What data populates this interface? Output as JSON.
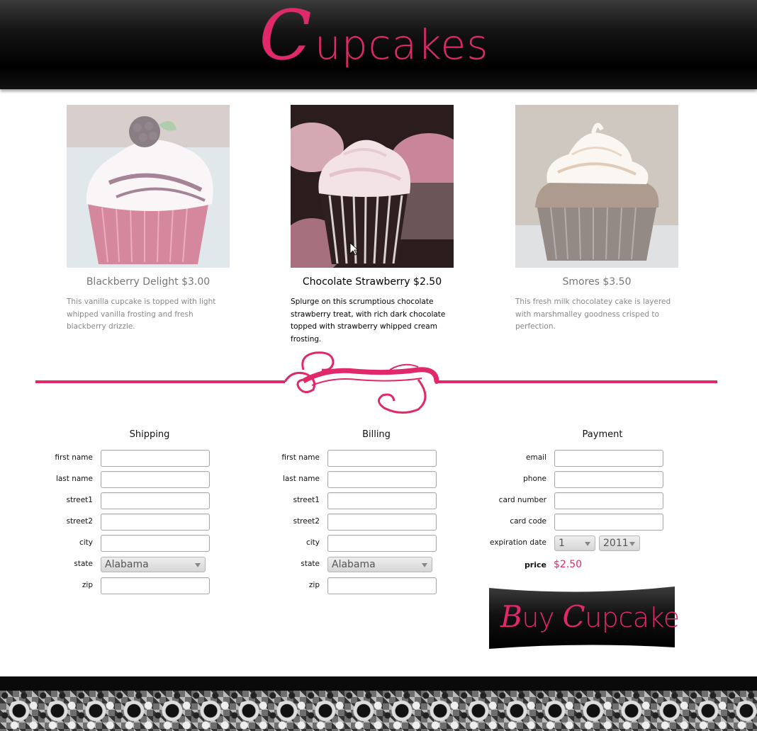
{
  "header": {
    "logo_initial": "C",
    "logo_text": "upcakes",
    "accent_color": "#e0286b"
  },
  "products": [
    {
      "name": "Blackberry Delight $3.00",
      "description": "This vanilla cupcake is topped with light whipped vanilla frosting and fresh blackberry drizzle.",
      "selected": false
    },
    {
      "name": "Chocolate Strawberry $2.50",
      "description": "Splurge on this scrumptious chocolate strawberry treat, with rich dark chocolate topped with strawberry whipped cream frosting.",
      "selected": true
    },
    {
      "name": "Smores $3.50",
      "description": "This fresh milk chocolatey cake is layered with marshmalley goodness crisped to perfection.",
      "selected": false
    }
  ],
  "shipping": {
    "title": "Shipping",
    "labels": {
      "first_name": "first name",
      "last_name": "last name",
      "street1": "street1",
      "street2": "street2",
      "city": "city",
      "state": "state",
      "zip": "zip"
    },
    "state_value": "Alabama"
  },
  "billing": {
    "title": "Billing",
    "labels": {
      "first_name": "first name",
      "last_name": "last name",
      "street1": "street1",
      "street2": "street2",
      "city": "city",
      "state": "state",
      "zip": "zip"
    },
    "state_value": "Alabama"
  },
  "payment": {
    "title": "Payment",
    "labels": {
      "email": "email",
      "phone": "phone",
      "card_number": "card number",
      "card_code": "card code",
      "expiration_date": "expiration date",
      "price": "price"
    },
    "exp_month": "1",
    "exp_year": "2011",
    "price_value": "$2.50"
  },
  "buy_button": {
    "initial_b": "B",
    "text1": "uy ",
    "initial_c": "C",
    "text2": "upcake"
  }
}
